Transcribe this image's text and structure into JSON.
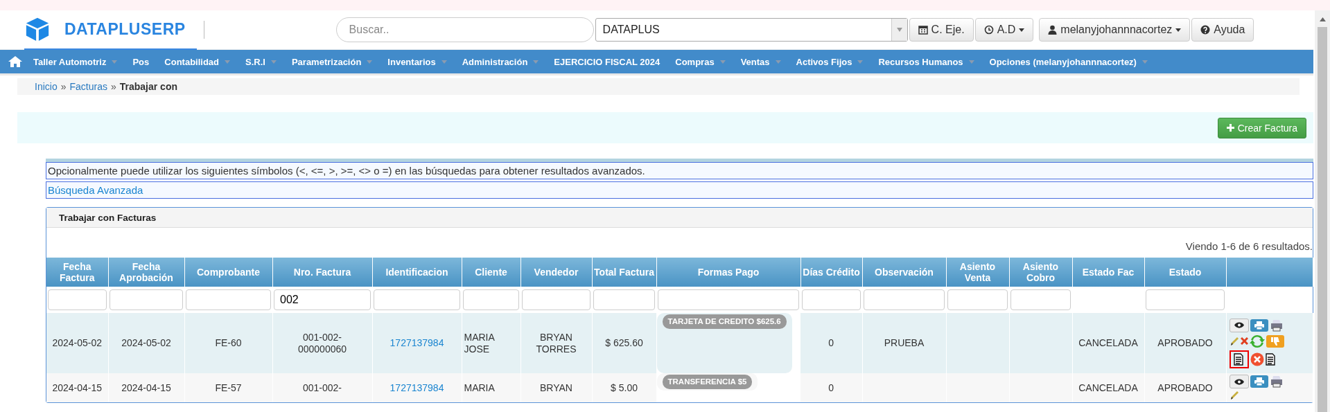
{
  "brand": "DATAPLUSERP",
  "search": {
    "placeholder": "Buscar.."
  },
  "company_select": {
    "value": "DATAPLUS"
  },
  "header_buttons": [
    {
      "kind": "calendar",
      "label": "C. Eje.",
      "caret": false
    },
    {
      "kind": "clock",
      "label": "A.D",
      "caret": true
    },
    {
      "kind": "user",
      "label": "melanyjohannnacortez",
      "caret": true
    },
    {
      "kind": "help",
      "label": "Ayuda",
      "caret": false
    }
  ],
  "nav": [
    {
      "label": "Taller Automotriz",
      "caret": true
    },
    {
      "label": "Pos",
      "caret": false
    },
    {
      "label": "Contabilidad",
      "caret": true
    },
    {
      "label": "S.R.I",
      "caret": true
    },
    {
      "label": "Parametrización",
      "caret": true
    },
    {
      "label": "Inventarios",
      "caret": true
    },
    {
      "label": "Administración",
      "caret": true
    },
    {
      "label": "EJERCICIO FISCAL 2024",
      "caret": false
    },
    {
      "label": "Compras",
      "caret": true
    },
    {
      "label": "Ventas",
      "caret": true
    },
    {
      "label": "Activos Fijos",
      "caret": true
    },
    {
      "label": "Recursos Humanos",
      "caret": true
    },
    {
      "label": "Opciones (melanyjohannnacortez)",
      "caret": true
    }
  ],
  "breadcrumb": [
    {
      "kind": "link",
      "label": "Inicio"
    },
    {
      "kind": "separator",
      "label": "»"
    },
    {
      "kind": "link",
      "label": "Facturas"
    },
    {
      "kind": "separator",
      "label": "»"
    },
    {
      "kind": "current",
      "label": "Trabajar con"
    }
  ],
  "create_button": "Crear Factura",
  "info_text": "Opcionalmente puede utilizar los siguientes símbolos (<, <=, >, >=, <> o =) en las búsquedas para obtener resultados avanzados.",
  "advanced_search": "Búsqueda Avanzada",
  "panel": {
    "title": "Trabajar con Facturas",
    "summary": "Viendo 1-6 de 6 resultados.",
    "table": {
      "columns": [
        "Fecha Factura",
        "Fecha Aprobación",
        "Comprobante",
        "Nro. Factura",
        "Identificacion",
        "Cliente",
        "Vendedor",
        "Total Factura",
        "Formas Pago",
        "Días Crédito",
        "Observación",
        "Asiento Venta",
        "Asiento Cobro",
        "Estado Fac",
        "Estado"
      ],
      "filters": [
        {
          "kind": "input"
        },
        {
          "kind": "input"
        },
        {
          "kind": "input"
        },
        {
          "kind": "input",
          "value": "002"
        },
        {
          "kind": "input"
        },
        {
          "kind": "input"
        },
        {
          "kind": "input"
        },
        {
          "kind": "input"
        },
        {
          "kind": "input"
        },
        {
          "kind": "input"
        },
        {
          "kind": "input"
        },
        {
          "kind": "input"
        },
        {
          "kind": "input"
        },
        {
          "kind": "none"
        },
        {
          "kind": "input"
        },
        {
          "kind": "none"
        }
      ],
      "rows": [
        {
          "fecha_factura": "2024-05-02",
          "fecha_aprobacion": "2024-05-02",
          "comprobante": "FE-60",
          "nro_factura": "001-002-\n000000060",
          "identificacion": "1727137984",
          "cliente": "MARIA\nJOSE",
          "vendedor": "BRYAN\nTORRES",
          "total": "$ 625.60",
          "formas_pago": "TARJETA DE CREDITO $625.6",
          "dias_credito": "0",
          "observacion": "PRUEBA",
          "estado_fac": "CANCELADA",
          "estado": "APROBADO",
          "actions": [
            {
              "kind": "view",
              "highlighted": false
            },
            {
              "kind": "print",
              "highlighted": false
            },
            {
              "kind": "printer",
              "highlighted": false
            },
            {
              "kind": "edit",
              "highlighted": false
            },
            {
              "kind": "delete",
              "highlighted": false
            },
            {
              "kind": "refresh",
              "highlighted": false
            },
            {
              "kind": "dislike",
              "highlighted": false
            },
            {
              "kind": "document",
              "highlighted": true
            },
            {
              "kind": "cancel",
              "highlighted": false
            },
            {
              "kind": "document",
              "highlighted": false
            }
          ]
        },
        {
          "fecha_factura": "2024-04-15",
          "fecha_aprobacion": "2024-04-15",
          "comprobante": "FE-57",
          "nro_factura": "001-002-",
          "identificacion": "1727137984",
          "cliente": "MARIA",
          "vendedor": "BRYAN",
          "total": "$ 5.00",
          "formas_pago": "TRANSFERENCIA $5",
          "dias_credito": "0",
          "estado_fac": "CANCELADA",
          "estado": "APROBADO",
          "actions": [
            {
              "kind": "view",
              "highlighted": false
            },
            {
              "kind": "print",
              "highlighted": false
            },
            {
              "kind": "printer",
              "highlighted": false
            },
            {
              "kind": "edit",
              "highlighted": false
            }
          ]
        }
      ]
    }
  }
}
